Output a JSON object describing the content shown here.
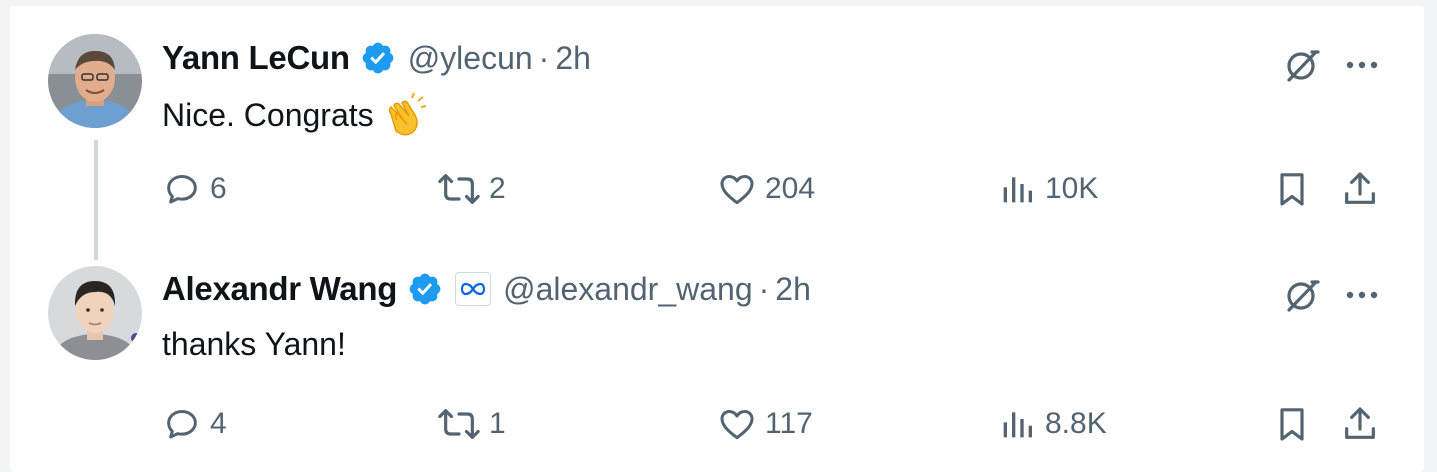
{
  "tweets": [
    {
      "author": "Yann LeCun",
      "handle": "@ylecun",
      "separator": "·",
      "time": "2h",
      "text": "Nice. Congrats",
      "emoji": "clapping-hands",
      "affiliation_badge": false,
      "stats": {
        "replies": "6",
        "reposts": "2",
        "likes": "204",
        "views": "10K"
      }
    },
    {
      "author": "Alexandr Wang",
      "handle": "@alexandr_wang",
      "separator": "·",
      "time": "2h",
      "text": "thanks Yann!",
      "affiliation_badge": true,
      "affiliation_icon": "meta-infinity-icon",
      "stats": {
        "replies": "4",
        "reposts": "1",
        "likes": "117",
        "views": "8.8K"
      }
    }
  ],
  "colors": {
    "verified": "#1d9bf0",
    "secondary_text": "#536471",
    "primary_text": "#0f1419",
    "thread_line": "#cfd9de",
    "meta_blue": "#0668e1"
  }
}
